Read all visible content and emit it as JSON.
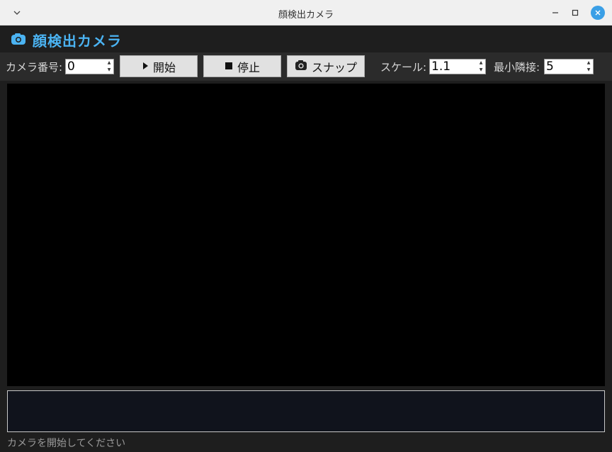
{
  "window": {
    "title": "顔検出カメラ"
  },
  "header": {
    "title": "顔検出カメラ"
  },
  "toolbar": {
    "camera_label": "カメラ番号:",
    "camera_value": "0",
    "start_label": "開始",
    "stop_label": "停止",
    "snap_label": "スナップ",
    "scale_label": "スケール:",
    "scale_value": "1.1",
    "neighbors_label": "最小隣接:",
    "neighbors_value": "5"
  },
  "status": {
    "text": "カメラを開始してください"
  },
  "colors": {
    "accent": "#4bb3f2",
    "close_button": "#3a9fe6",
    "background": "#1e1e1e",
    "toolbar": "#2b2b2b"
  },
  "icons": {
    "window_menu": "chevron-down-icon",
    "minimize": "minimize-icon",
    "maximize": "maximize-icon",
    "close": "close-icon",
    "app": "camera-icon",
    "start": "play-icon",
    "stop": "stop-icon",
    "snap": "camera-icon"
  }
}
